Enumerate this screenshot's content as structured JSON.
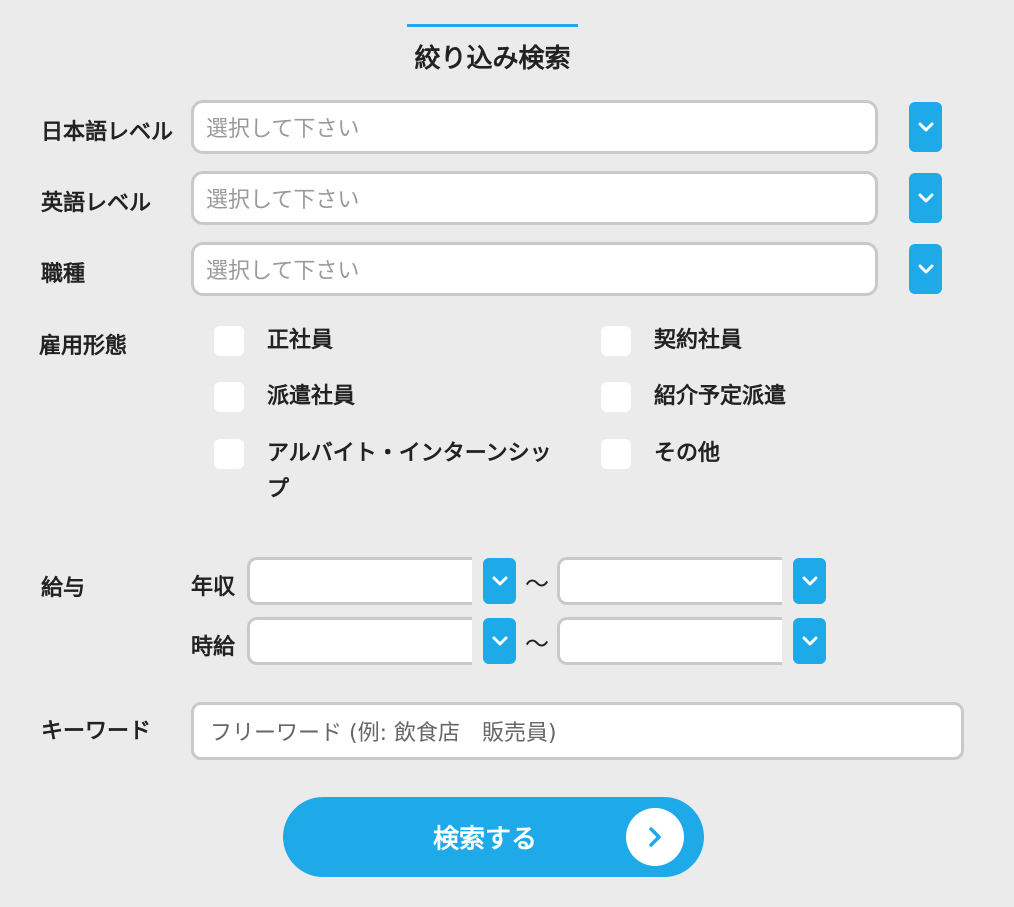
{
  "title": "絞り込み検索",
  "fields": {
    "japanese_level": {
      "label": "日本語レベル",
      "placeholder": "選択して下さい"
    },
    "english_level": {
      "label": "英語レベル",
      "placeholder": "選択して下さい"
    },
    "job_type": {
      "label": "職種",
      "placeholder": "選択して下さい"
    }
  },
  "employment": {
    "label": "雇用形態",
    "options": [
      "正社員",
      "契約社員",
      "派遣社員",
      "紹介予定派遣",
      "アルバイト・インターンシップ",
      "その他"
    ]
  },
  "salary": {
    "label": "給与",
    "annual_label": "年収",
    "hourly_label": "時給",
    "range_sep": "〜"
  },
  "keyword": {
    "label": "キーワード",
    "placeholder": "フリーワード (例: 飲食店　販売員)"
  },
  "search_button": {
    "label": "検索する"
  },
  "icons": {
    "dropdown": "chevron-down-icon",
    "submit": "chevron-right-icon"
  },
  "colors": {
    "accent": "#1eaae8",
    "background": "#ebebeb",
    "border": "#c9c9c9"
  }
}
